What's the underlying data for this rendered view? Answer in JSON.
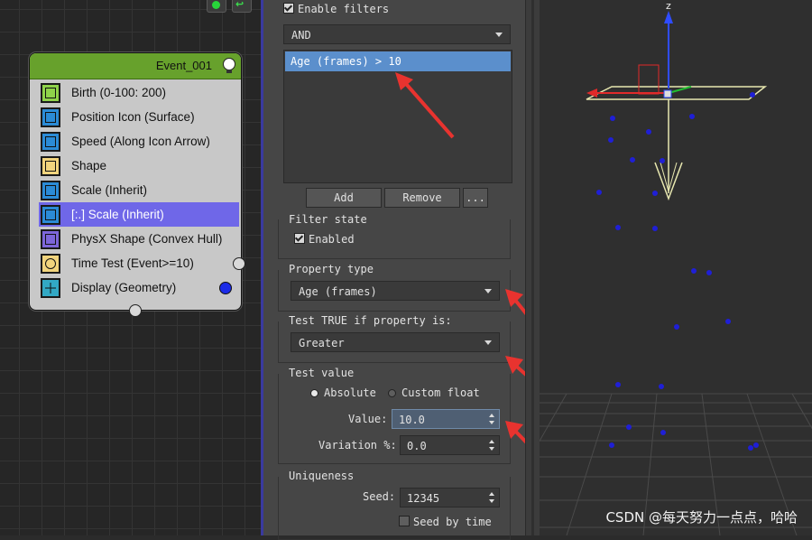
{
  "graph": {
    "event": {
      "title": "Event_001",
      "operators": [
        {
          "label": "Birth (0-100: 200)",
          "icon": "birth-icon"
        },
        {
          "label": "Position Icon (Surface)",
          "icon": "position-icon"
        },
        {
          "label": "Speed (Along Icon Arrow)",
          "icon": "speed-icon"
        },
        {
          "label": "Shape",
          "icon": "shape-icon"
        },
        {
          "label": "Scale (Inherit)",
          "icon": "scale-icon"
        },
        {
          "label": "[:.] Scale (Inherit)",
          "icon": "scale-icon",
          "selected": true
        },
        {
          "label": "PhysX Shape (Convex Hull)",
          "icon": "physx-shape-icon"
        },
        {
          "label": "Time Test (Event>=10)",
          "icon": "clock-icon"
        },
        {
          "label": "Display (Geometry)",
          "icon": "display-icon"
        }
      ]
    }
  },
  "panel": {
    "enable_filters": "Enable filters",
    "logic_combo": "AND",
    "filter_list": [
      "Age (frames) > 10"
    ],
    "add_btn": "Add",
    "remove_btn": "Remove",
    "more_btn": "...",
    "filter_state": {
      "title": "Filter state",
      "enabled": "Enabled"
    },
    "property_type": {
      "title": "Property type",
      "value": "Age (frames)"
    },
    "test_true": {
      "title": "Test TRUE if property is:",
      "value": "Greater"
    },
    "test_value": {
      "title": "Test value",
      "absolute": "Absolute",
      "custom_float": "Custom float",
      "value_label": "Value:",
      "value": "10.0",
      "variation_label": "Variation %:",
      "variation": "0.0"
    },
    "uniqueness": {
      "title": "Uniqueness",
      "seed_label": "Seed:",
      "seed": "12345",
      "seed_by_time": "Seed by time"
    }
  },
  "viewport": {
    "axis_z": "z"
  },
  "watermark": "CSDN @每天努力一点点，哈哈",
  "colors": {
    "event_header": "#67a12c",
    "selected_row": "#6f67e8",
    "list_selection": "#5b8fcc",
    "particle": "#1f1fd6",
    "annotation_arrow": "#e8332f"
  }
}
